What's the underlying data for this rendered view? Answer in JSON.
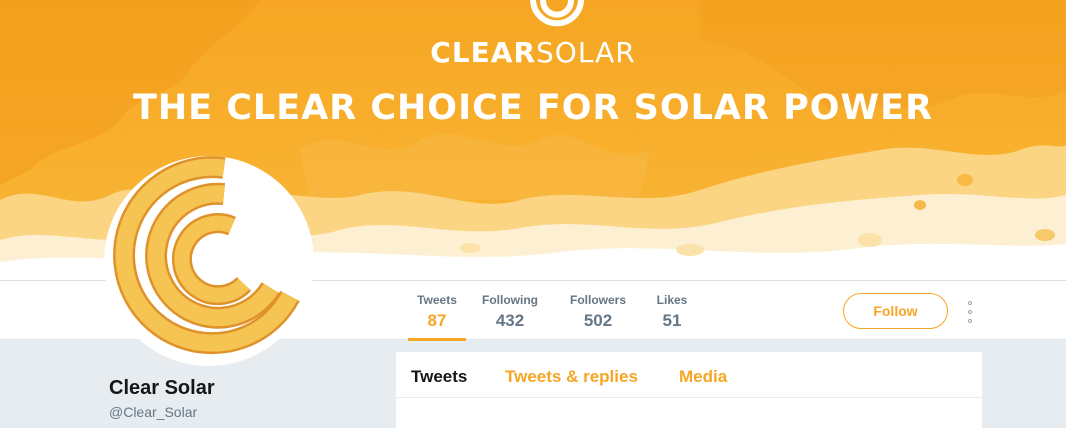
{
  "banner": {
    "brand_bold": "CLEAR",
    "brand_thin": "SOLAR",
    "tagline": "THE CLEAR CHOICE FOR SOLAR POWER",
    "colors": {
      "orange": "#f6a623",
      "light": "#fde3a3",
      "cream": "#fdf4dd"
    }
  },
  "stats": [
    {
      "label": "Tweets",
      "value": "87"
    },
    {
      "label": "Following",
      "value": "432"
    },
    {
      "label": "Followers",
      "value": "502"
    },
    {
      "label": "Likes",
      "value": "51"
    }
  ],
  "follow_label": "Follow",
  "more_icon": "vertical-dots-icon",
  "profile": {
    "name": "Clear Solar",
    "handle": "@Clear_Solar"
  },
  "tabs": [
    {
      "label": "Tweets"
    },
    {
      "label": "Tweets & replies"
    },
    {
      "label": "Media"
    }
  ]
}
